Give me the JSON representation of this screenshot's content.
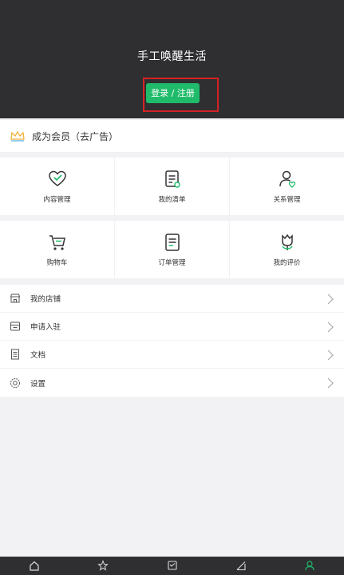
{
  "header": {
    "app_title": "手工唤醒生活",
    "login_label": "登录 / 注册"
  },
  "vip": {
    "label": "成为会员（去广告）",
    "icon": "crown-icon"
  },
  "grid_row_1": [
    {
      "label": "内容管理",
      "icon": "heart-edit-icon"
    },
    {
      "label": "我的清单",
      "icon": "list-doc-icon"
    },
    {
      "label": "关系管理",
      "icon": "user-heart-icon"
    }
  ],
  "grid_row_2": [
    {
      "label": "购物车",
      "icon": "cart-icon"
    },
    {
      "label": "订单管理",
      "icon": "order-doc-icon"
    },
    {
      "label": "我的评价",
      "icon": "flower-icon"
    }
  ],
  "list": [
    {
      "label": "我的店铺",
      "icon": "shop-icon"
    },
    {
      "label": "申请入驻",
      "icon": "store-icon"
    },
    {
      "label": "文档",
      "icon": "document-icon"
    },
    {
      "label": "设置",
      "icon": "gear-icon"
    }
  ],
  "tabbar": [
    {
      "icon": "home-icon"
    },
    {
      "icon": "discover-icon"
    },
    {
      "icon": "message-icon"
    },
    {
      "icon": "pen-icon"
    },
    {
      "icon": "profile-icon"
    }
  ],
  "colors": {
    "header_bg": "#2f2f31",
    "accent_green": "#1fbb6a",
    "highlight_red": "#d32224",
    "page_bg": "#f2f2f4"
  }
}
